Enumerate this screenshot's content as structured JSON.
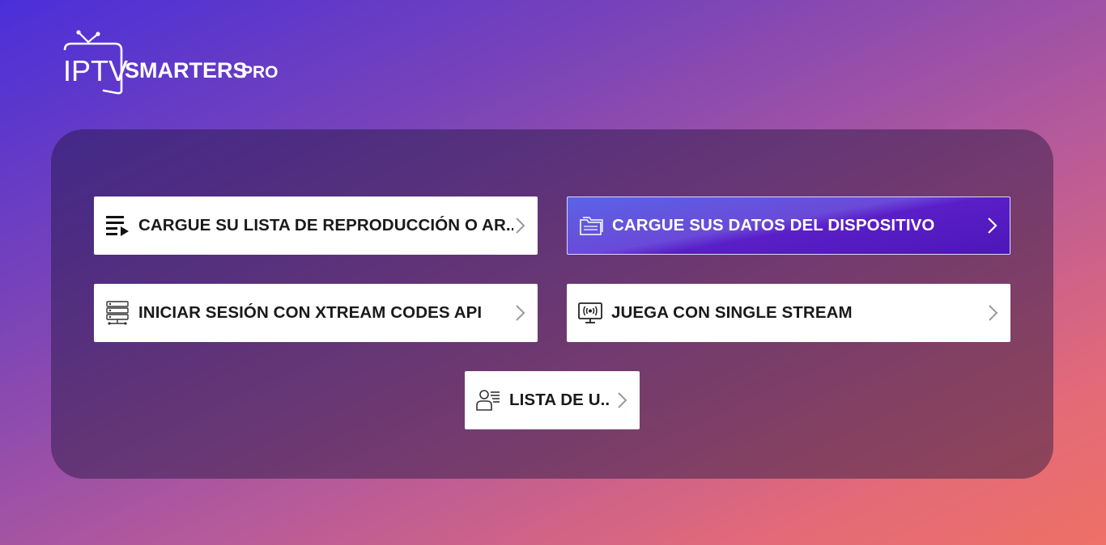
{
  "app": {
    "logo_iptv": "IPTV",
    "logo_smarters": "SMARTERS",
    "logo_pro": "PRO"
  },
  "menu": {
    "playlist_label": "CARGUE SU LISTA DE REPRODUCCIÓN O AR..",
    "device_label": "CARGUE SUS DATOS DEL DISPOSITIVO",
    "xtream_label": "INICIAR SESIÓN CON XTREAM CODES API",
    "single_stream_label": "JUEGA CON SINGLE STREAM",
    "users_label": "LISTA DE U.."
  },
  "icons": {
    "playlist": "playlist-icon",
    "device": "folder-icon",
    "xtream": "server-icon",
    "single_stream": "monitor-broadcast-icon",
    "users": "user-list-icon",
    "chevron": "chevron-right-icon"
  },
  "colors": {
    "active_button_start": "#5a63e6",
    "active_button_end": "#4d17b8",
    "button_bg": "#ffffff",
    "label_dark": "#1a1a1a"
  }
}
